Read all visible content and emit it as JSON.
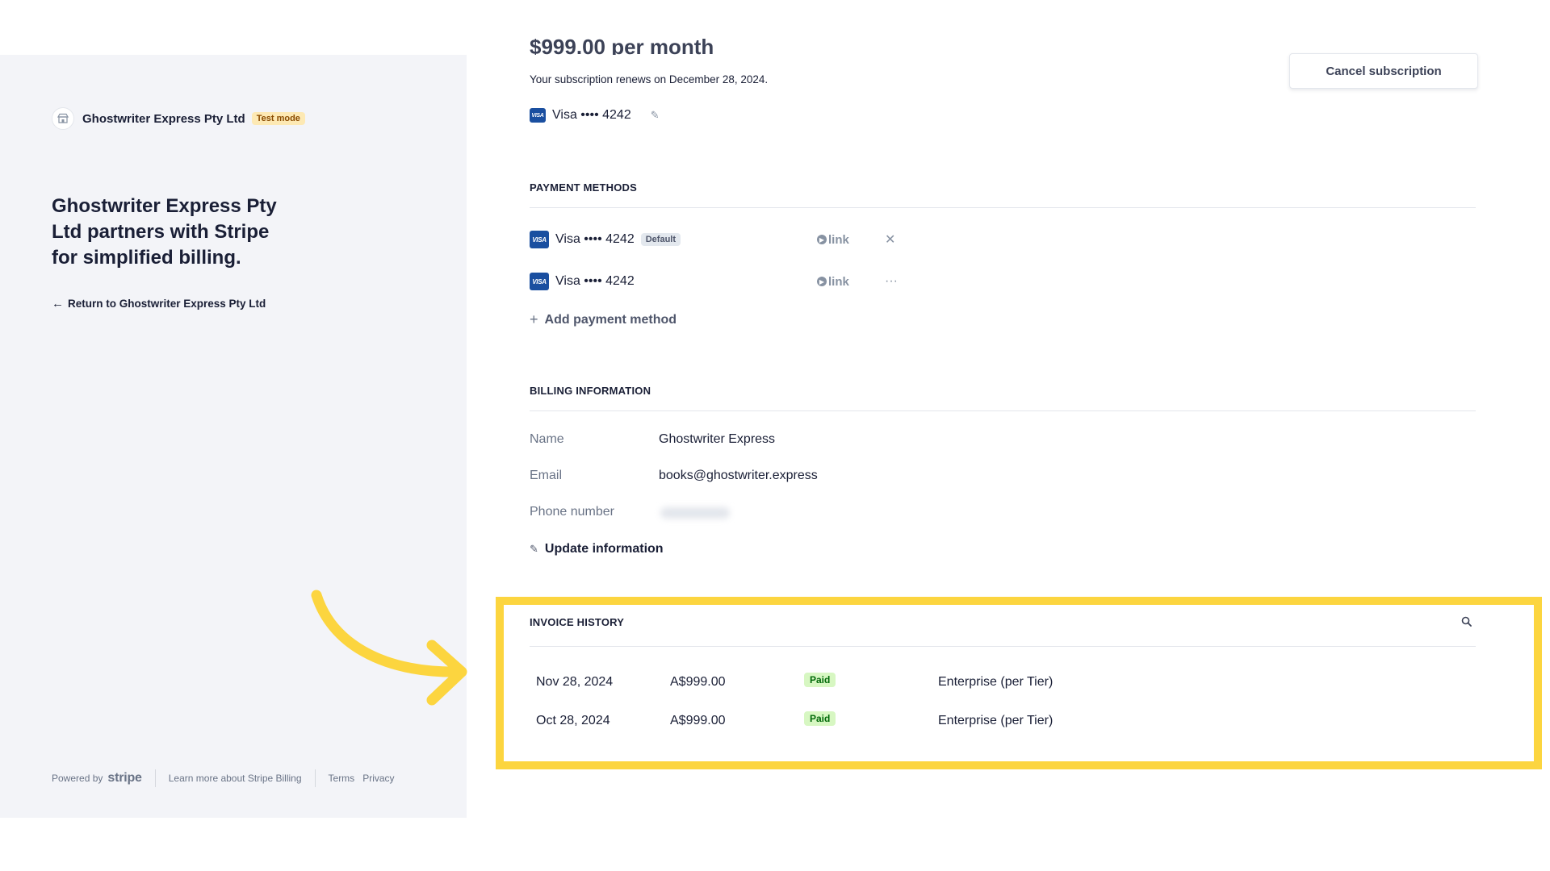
{
  "brand": {
    "name": "Ghostwriter Express Pty Ltd",
    "badge": "Test mode",
    "logo_icon": "storefront-icon"
  },
  "left": {
    "tagline": "Ghostwriter Express Pty Ltd partners with Stripe for simplified billing.",
    "return_link": "Return to Ghostwriter Express Pty Ltd",
    "footer": {
      "powered_by": "Powered by",
      "stripe": "stripe",
      "learn_more": "Learn more about Stripe Billing",
      "terms": "Terms",
      "privacy": "Privacy"
    }
  },
  "subscription": {
    "price_partial": "$999.00 per month",
    "renewal": "Your subscription renews on December 28, 2024.",
    "card": "Visa •••• 4242",
    "cancel_label": "Cancel subscription"
  },
  "payment_methods": {
    "title": "PAYMENT METHODS",
    "items": [
      {
        "brand": "VISA",
        "label": "Visa •••• 4242",
        "badge": "Default",
        "wallet": "link",
        "action_icon": "close-icon",
        "action_glyph": "✕"
      },
      {
        "brand": "VISA",
        "label": "Visa •••• 4242",
        "badge": "",
        "wallet": "link",
        "action_icon": "more-icon",
        "action_glyph": "···"
      }
    ],
    "add_label": "Add payment method"
  },
  "billing": {
    "title": "BILLING INFORMATION",
    "name_label": "Name",
    "name_value": "Ghostwriter Express",
    "email_label": "Email",
    "email_value": "books@ghostwriter.express",
    "phone_label": "Phone number",
    "update_label": "Update information"
  },
  "invoices": {
    "title": "INVOICE HISTORY",
    "rows": [
      {
        "date": "Nov 28, 2024",
        "amount": "A$999.00",
        "status": "Paid",
        "plan": "Enterprise (per Tier)"
      },
      {
        "date": "Oct 28, 2024",
        "amount": "A$999.00",
        "status": "Paid",
        "plan": "Enterprise (per Tier)"
      }
    ]
  },
  "colors": {
    "highlight": "#fcd53f",
    "paid_bg": "#d7f7c2",
    "paid_text": "#006908",
    "test_badge_bg": "#fde9b4",
    "visa_blue": "#1a4fa0"
  }
}
